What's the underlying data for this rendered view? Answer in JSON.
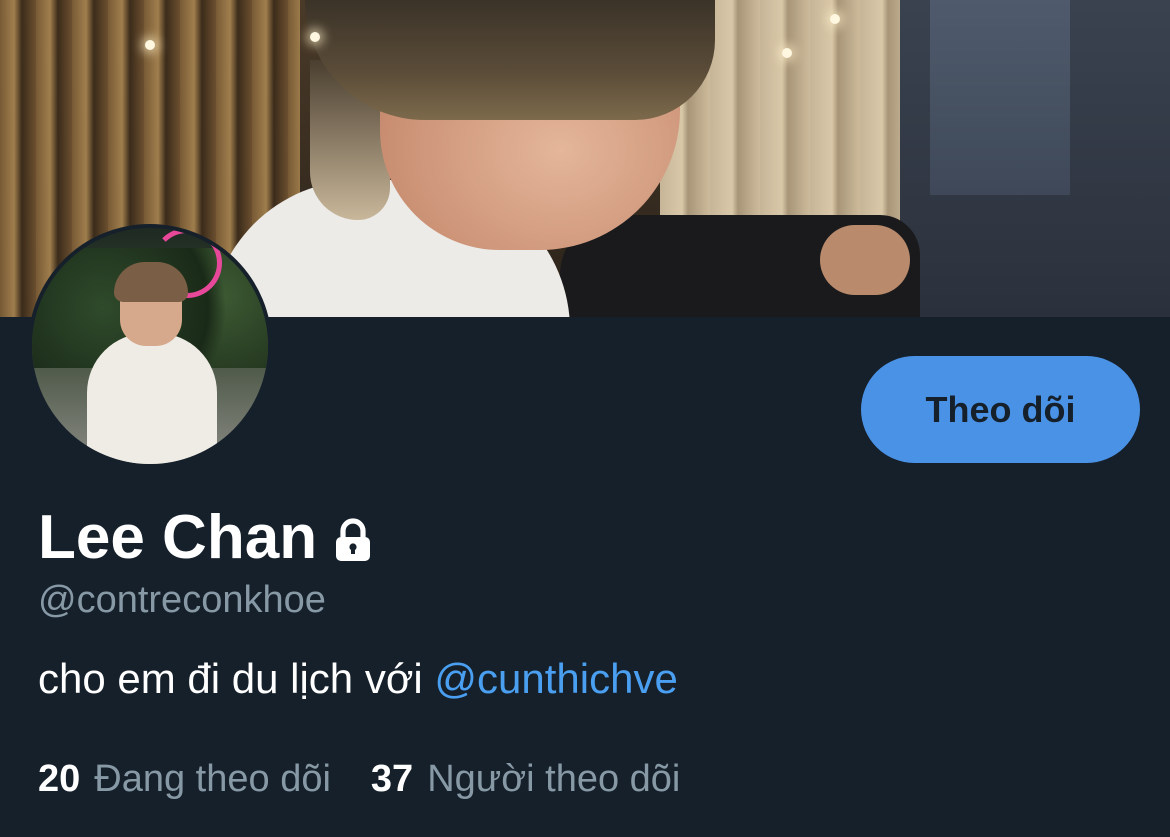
{
  "profile": {
    "display_name": "Lee Chan",
    "handle": "@contreconkhoe",
    "bio_text": "cho em đi du lịch với ",
    "bio_mention": "@cunthichve",
    "locked_icon": "lock-icon",
    "follow_button_label": "Theo dõi"
  },
  "stats": {
    "following_count": "20",
    "following_label": "Đang theo dõi",
    "followers_count": "37",
    "followers_label": "Người theo dõi"
  },
  "colors": {
    "background": "#15202b",
    "accent": "#4a92e6",
    "mention": "#4a9ff0",
    "secondary_text": "#8899a6"
  }
}
